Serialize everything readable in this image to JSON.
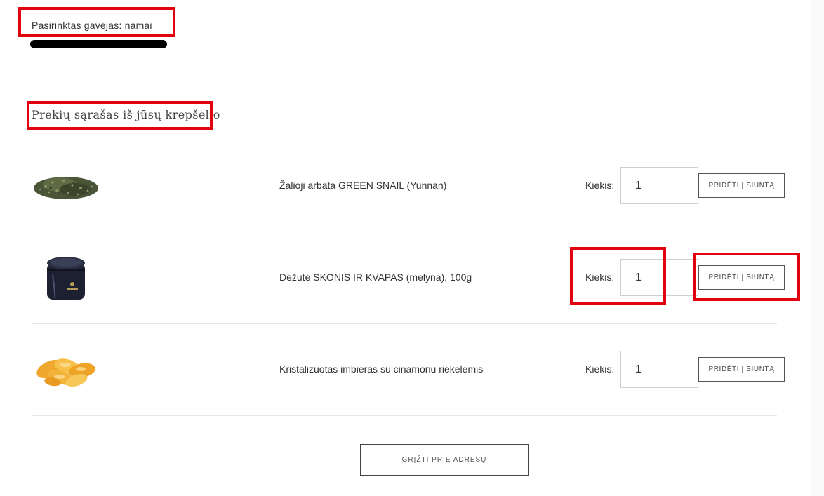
{
  "recipient": {
    "text": "Pasirinktas gavėjas: namai"
  },
  "section": {
    "title": "Prekių sąrašas iš jūsų krepšelio"
  },
  "products": [
    {
      "name": "Žalioji arbata GREEN SNAIL (Yunnan)",
      "qty_label": "Kiekis:",
      "qty": "1",
      "add_label": "PRIDĖTI Į SIUNTĄ",
      "image": "green-tea-image"
    },
    {
      "name": "Dėžutė SKONIS IR KVAPAS (mėlyna), 100g",
      "qty_label": "Kiekis:",
      "qty": "1",
      "add_label": "PRIDĖTI Į SIUNTĄ",
      "image": "tin-box-image"
    },
    {
      "name": "Kristalizuotas imbieras su cinamonu riekelėmis",
      "qty_label": "Kiekis:",
      "qty": "1",
      "add_label": "PRIDĖTI Į SIUNTĄ",
      "image": "ginger-slices-image"
    }
  ],
  "back_button": {
    "label": "GRĮŽTI PRIE ADRESŲ"
  },
  "colors": {
    "highlight": "#e3000f",
    "text": "#333333",
    "divider": "#e6e6e6"
  }
}
